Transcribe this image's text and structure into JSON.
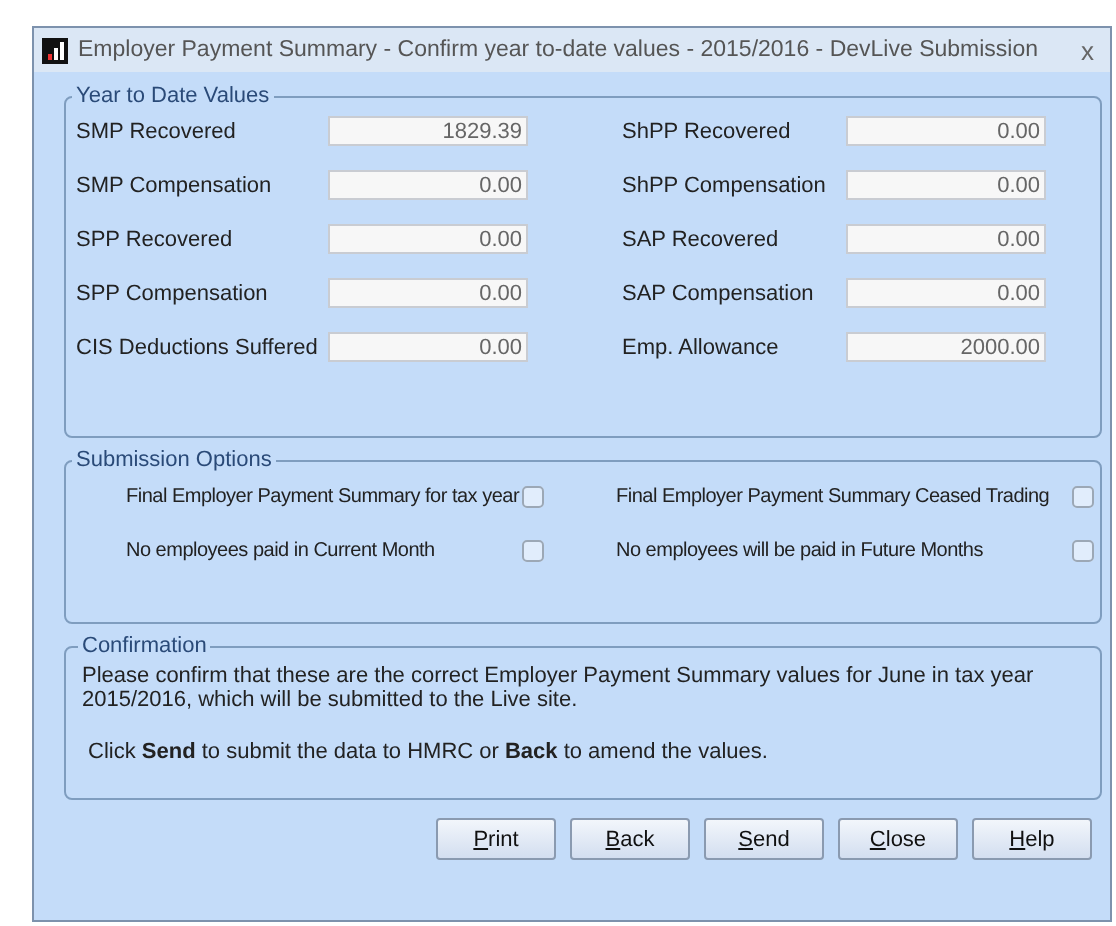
{
  "window": {
    "title": "Employer Payment Summary - Confirm year to-date values - 2015/2016 - DevLive Submission",
    "close": "x"
  },
  "year_to_date": {
    "title": "Year to Date Values",
    "fields": [
      {
        "label": "SMP Recovered",
        "value": "1829.39"
      },
      {
        "label": "ShPP Recovered",
        "value": "0.00"
      },
      {
        "label": "SMP Compensation",
        "value": "0.00"
      },
      {
        "label": "ShPP Compensation",
        "value": "0.00"
      },
      {
        "label": "SPP Recovered",
        "value": "0.00"
      },
      {
        "label": "SAP Recovered",
        "value": "0.00"
      },
      {
        "label": "SPP Compensation",
        "value": "0.00"
      },
      {
        "label": "SAP Compensation",
        "value": "0.00"
      },
      {
        "label": "CIS Deductions Suffered",
        "value": "0.00"
      },
      {
        "label": "Emp. Allowance",
        "value": "2000.00"
      }
    ]
  },
  "submission_options": {
    "title": "Submission Options",
    "options": [
      {
        "label": "Final Employer Payment Summary for tax year",
        "checked": false
      },
      {
        "label": "Final Employer Payment Summary Ceased Trading",
        "checked": false
      },
      {
        "label": "No employees paid in Current Month",
        "checked": false
      },
      {
        "label": "No employees will be paid in Future Months",
        "checked": false
      }
    ]
  },
  "confirmation": {
    "title": "Confirmation",
    "paragraphs": [
      "Please confirm that these are the correct Employer Payment Summary values for June in tax year 2015/2016, which will be submitted to the Live site.",
      "Click **Send** to submit the data to HMRC or **Back** to amend the values."
    ]
  },
  "buttons": [
    "Print",
    "Back",
    "Send",
    "Close",
    "Help"
  ]
}
